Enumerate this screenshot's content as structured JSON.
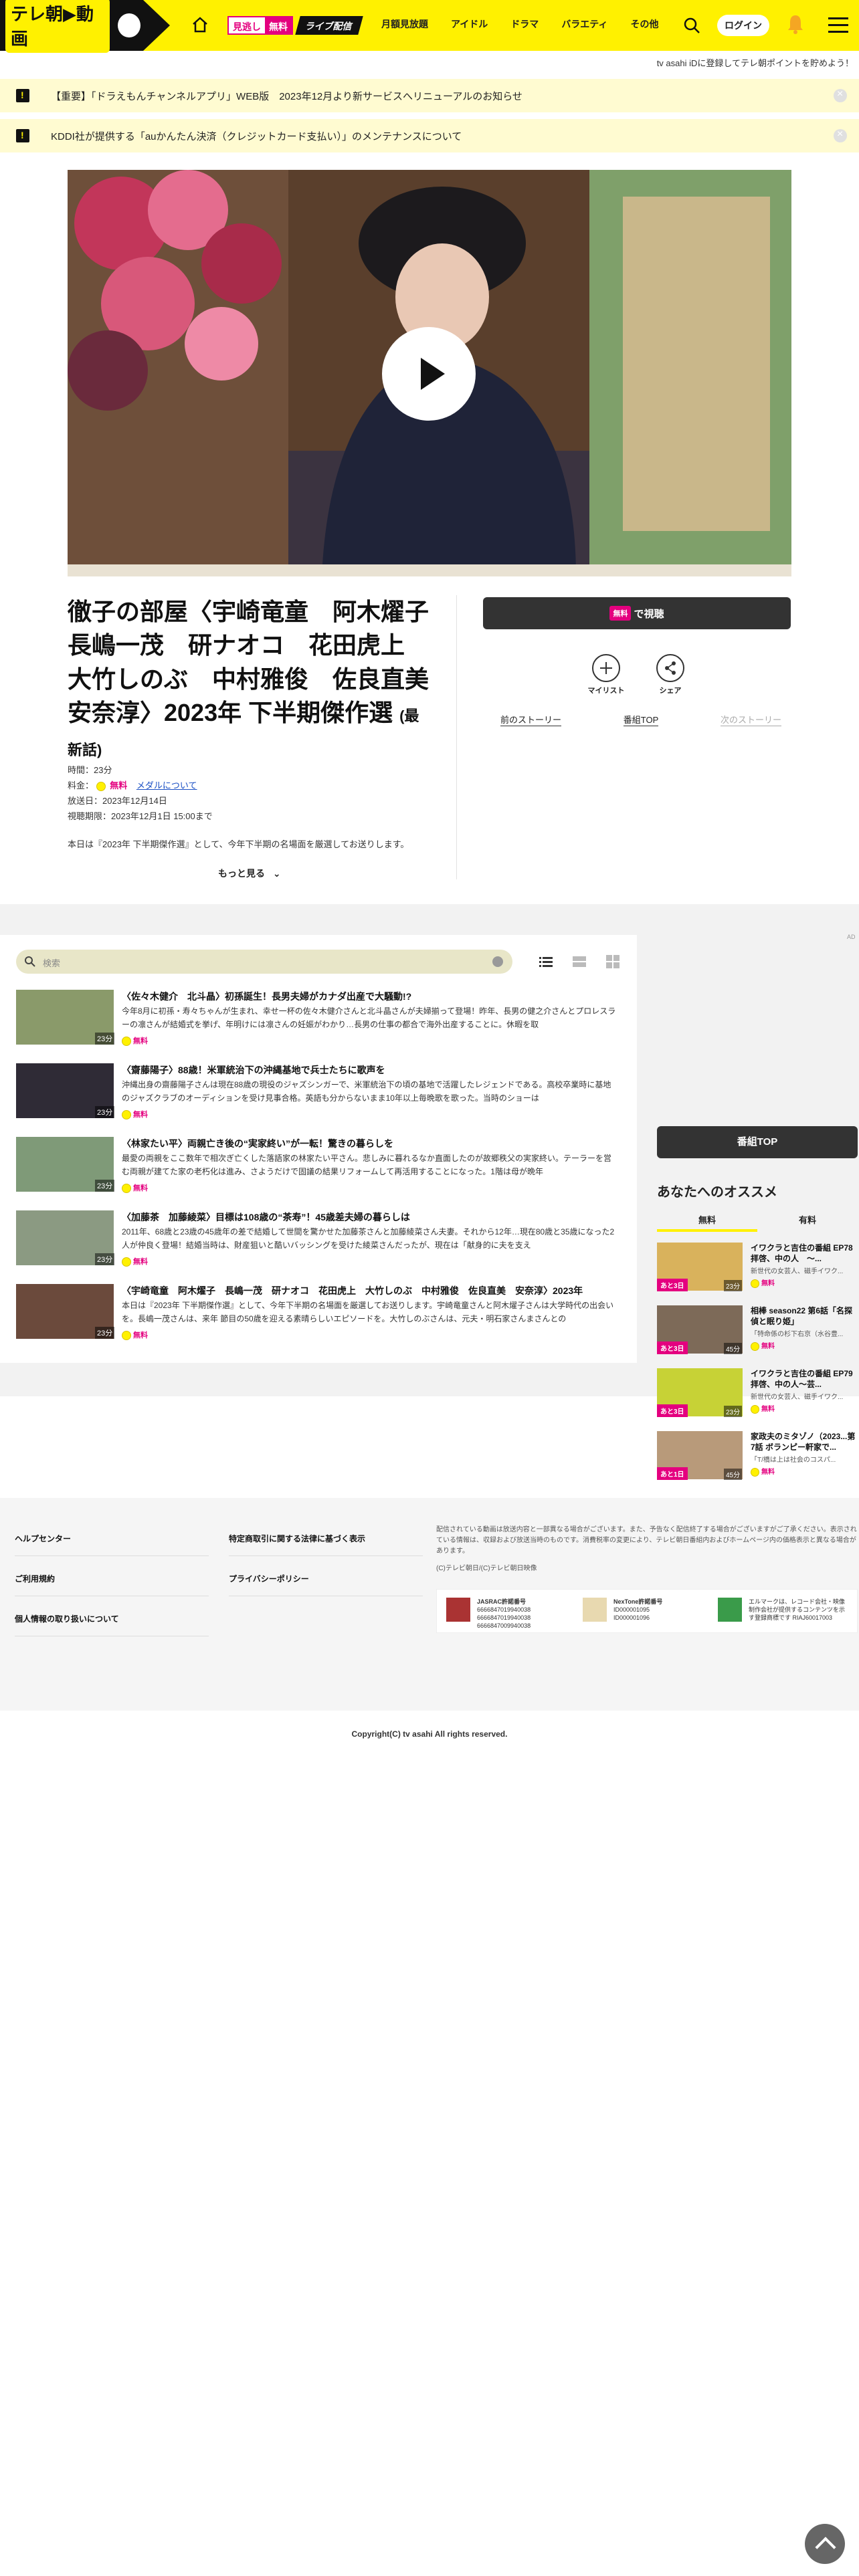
{
  "header": {
    "logo_text": "テレ朝▶動画",
    "mitsu_a": "見逃し",
    "mitsu_b": "無料",
    "live": "ライブ配信",
    "nav": [
      "月額見放題",
      "アイドル",
      "ドラマ",
      "バラエティ",
      "その他"
    ],
    "login": "ログイン"
  },
  "point_bar": "tv asahi iDに登録してテレ朝ポイントを貯めよう！",
  "notices": [
    "【重要】「ドラえもんチャンネルアプリ」WEB版　2023年12月より新サービスへリニューアルのお知らせ",
    "KDDI社が提供する「auかんたん決済（クレジットカード支払い）」のメンテナンスについて"
  ],
  "episode": {
    "title": "徹子の部屋〈宇崎竜童　阿木燿子　長嶋一茂　研ナオコ　花田虎上　大竹しのぶ　中村雅俊　佐良直美　安奈淳〉2023年 下半期傑作選",
    "latest": "(最新話)",
    "duration": "時間：23分",
    "price_label": "料金：",
    "price_free": "無料",
    "medal_link": "メダルについて",
    "aired": "放送日：2023年12月14日",
    "until": "視聴期限：2023年12月1日 15:00まで",
    "description": "本日は『2023年 下半期傑作選』として、今年下半期の名場面を厳選してお送りします。",
    "more": "もっと見る",
    "watch_tag": "無料",
    "watch_label": "で視聴",
    "mylist": "マイリスト",
    "share": "シェア",
    "prev": "前のストーリー",
    "top": "番組TOP",
    "next": "次のストーリー"
  },
  "list": {
    "search_placeholder": "検索",
    "items": [
      {
        "title": "〈佐々木健介　北斗晶〉初孫誕生！長男夫婦がカナダ出産で大騒動!?",
        "desc": "今年8月に初孫・寿々ちゃんが生まれ、幸せ一杯の佐々木健介さんと北斗晶さんが夫婦揃って登場！昨年、長男の健之介さんとプロレスラーの凛さんが結婚式を挙げ、年明けには凛さんの妊娠がわかり…長男の仕事の都合で海外出産することに。休暇を取",
        "dur": "23分",
        "free": "無料"
      },
      {
        "title": "〈齋藤陽子〉88歳！米軍統治下の沖縄基地で兵士たちに歌声を",
        "desc": "沖縄出身の齋藤陽子さんは現在88歳の現役のジャズシンガーで、米軍統治下の頃の基地で活躍したレジェンドである。高校卒業時に基地のジャズクラブのオーディションを受け見事合格。英語も分からないまま10年以上毎晩歌を歌った。当時のショーは",
        "dur": "23分",
        "free": "無料"
      },
      {
        "title": "〈林家たい平〉両親亡き後の“実家終い”が一転！驚きの暮らしを",
        "desc": "最愛の両親をここ数年で相次ぎ亡くした落語家の林家たい平さん。悲しみに暮れるなか直面したのが故郷秩父の実家終い。テーラーを営む両親が建てた家の老朽化は進み、さようだけで固議の結果リフォームして再活用することになった。1階は母が晩年",
        "dur": "23分",
        "free": "無料"
      },
      {
        "title": "〈加藤茶　加藤綾菜〉目標は108歳の“茶寿”！45歳差夫婦の暮らしは",
        "desc": "2011年、68歳と23歳の45歳年の差で結婚して世間を驚かせた加藤茶さんと加藤綾菜さん夫妻。それから12年…現在80歳と35歳になった2人が仲良く登場！結婚当時は、財産狙いと酷いバッシングを受けた綾菜さんだったが、現在は「献身的に夫を支え",
        "dur": "23分",
        "free": "無料"
      },
      {
        "title": "〈宇崎竜童　阿木燿子　長嶋一茂　研ナオコ　花田虎上　大竹しのぶ　中村雅俊　佐良直美　安奈淳〉2023年",
        "desc": "本日は『2023年 下半期傑作選』として、今年下半期の名場面を厳選してお送りします。宇崎竜童さんと阿木燿子さんは大学時代の出会いを。長嶋一茂さんは、来年 節目の50歳を迎える素晴らしいエピソードを。大竹しのぶさんは、元夫・明石家さんまさんとの",
        "dur": "23分",
        "free": "無料"
      }
    ]
  },
  "sidebar": {
    "ad": "AD",
    "top_button": "番組TOP",
    "reco_title": "あなたへのオススメ",
    "tab_free": "無料",
    "tab_paid": "有料",
    "items": [
      {
        "title": "イワクラと吉住の番組 EP78 拝啓、中の人　〜...",
        "desc": "新世代の女芸人、磁手イワク...",
        "left": "あと3日",
        "dur": "23分",
        "free": "無料"
      },
      {
        "title": "相棒 season22 第6話「名探偵と眠り姫」",
        "desc": "「特命係の杉下右京（水谷豊...",
        "left": "あと3日",
        "dur": "45分",
        "free": "無料"
      },
      {
        "title": "イワクラと吉住の番組 EP79 拝啓、中の人〜芸...",
        "desc": "新世代の女芸人、磁手イワク...",
        "left": "あと3日",
        "dur": "23分",
        "free": "無料"
      },
      {
        "title": "家政夫のミタゾノ（2023...第7話 ボランピー軒家で...",
        "desc": "「T/橋は上は社会のコスパ...",
        "left": "あと1日",
        "dur": "45分",
        "free": "無料"
      }
    ]
  },
  "footer": {
    "links_left": [
      "ヘルプセンター",
      "ご利用規約",
      "個人情報の取り扱いについて"
    ],
    "links_right": [
      "特定商取引に関する法律に基づく表示",
      "プライバシーポリシー"
    ],
    "note": "配信されている動画は放送内容と一部異なる場合がございます。また、予告なく配信終了する場合がございますがご了承ください。表示されている情報は、収録および放送当時のものです。消費税率の変更により、テレビ朝日番組内およびホームページ内の価格表示と異なる場合があります。",
    "note2": "(C)テレビ朝日/(C)テレビ朝日映像",
    "lic1_title": "JASRAC許諾番号",
    "lic1": [
      "6666847019940038",
      "6666847019940038",
      "6666847009940038"
    ],
    "lic2_title": "NexTone許諾番号",
    "lic2": [
      "ID000001095",
      "ID000001096"
    ],
    "lic3": "エルマークは、レコード会社・映像制作会社が提供するコンテンツを示す登録商標です RIAJ60017003",
    "copyright": "Copyright(C) tv asahi All rights reserved."
  }
}
